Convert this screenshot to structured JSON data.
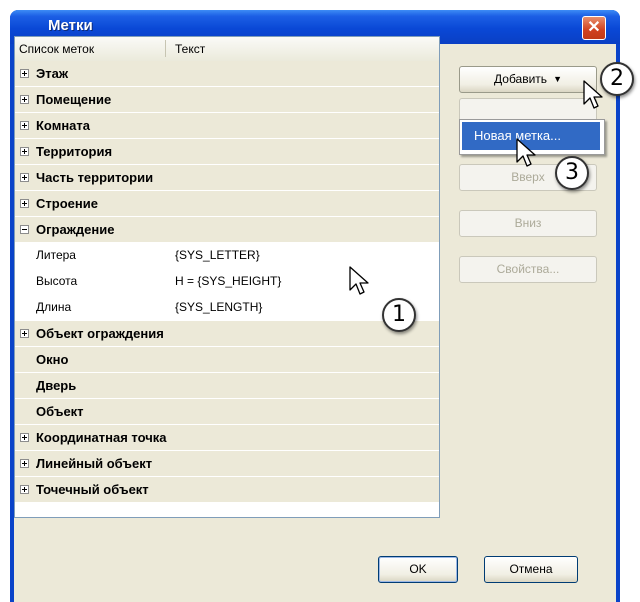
{
  "window": {
    "title": "Метки",
    "close_glyph": "✕"
  },
  "tree": {
    "headers": [
      "Список меток",
      "Текст"
    ],
    "rows": [
      {
        "type": "cat",
        "label": "Этаж",
        "expander": "plus"
      },
      {
        "type": "cat",
        "label": "Помещение",
        "expander": "plus"
      },
      {
        "type": "cat",
        "label": "Комната",
        "expander": "plus"
      },
      {
        "type": "cat",
        "label": "Территория",
        "expander": "plus"
      },
      {
        "type": "cat",
        "label": "Часть территории",
        "expander": "plus"
      },
      {
        "type": "cat",
        "label": "Строение",
        "expander": "plus"
      },
      {
        "type": "cat",
        "label": "Ограждение",
        "expander": "minus"
      },
      {
        "type": "child",
        "name": "Литера",
        "text": "{SYS_LETTER}"
      },
      {
        "type": "child",
        "name": "Высота",
        "text": "H = {SYS_HEIGHT}"
      },
      {
        "type": "child",
        "name": "Длина",
        "text": "{SYS_LENGTH}"
      },
      {
        "type": "cat",
        "label": "Объект ограждения",
        "expander": "plus"
      },
      {
        "type": "cat",
        "label": "Окно",
        "expander": "none"
      },
      {
        "type": "cat",
        "label": "Дверь",
        "expander": "none"
      },
      {
        "type": "cat",
        "label": "Объект",
        "expander": "none"
      },
      {
        "type": "cat",
        "label": "Координатная точка",
        "expander": "plus"
      },
      {
        "type": "cat",
        "label": "Линейный объект",
        "expander": "plus"
      },
      {
        "type": "cat",
        "label": "Точечный объект",
        "expander": "plus"
      }
    ]
  },
  "side_buttons": {
    "add": "Добавить",
    "up": "Вверх",
    "down": "Вниз",
    "properties": "Свойства..."
  },
  "dropdown_menu": {
    "item": "Новая метка..."
  },
  "footer": {
    "ok": "OK",
    "cancel": "Отмена"
  },
  "callouts": [
    "1",
    "2",
    "3"
  ],
  "colors": {
    "titlebar": "#0a48d6",
    "menu_highlight": "#316ac5",
    "dialog_bg": "#ece9d8",
    "close_button": "#d0411f"
  }
}
